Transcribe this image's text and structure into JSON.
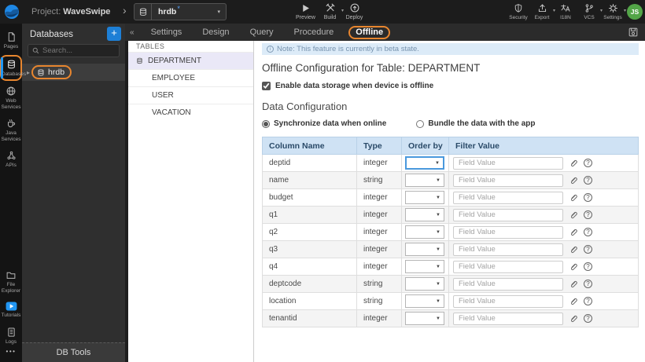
{
  "header": {
    "project_prefix": "Project:",
    "project_name": "WaveSwipe",
    "db_selector_value": "hrdb",
    "db_dirty": "*",
    "preview_label": "Preview",
    "build_label": "Build",
    "deploy_label": "Deploy",
    "security_label": "Security",
    "export_label": "Export",
    "i18n_label": "I18N",
    "vcs_label": "VCS",
    "settings_label": "Settings",
    "avatar_initials": "JS"
  },
  "sidebar": {
    "items": [
      {
        "label": "Pages"
      },
      {
        "label": "Databases"
      },
      {
        "label": "Web Services"
      },
      {
        "label": "Java Services"
      },
      {
        "label": "APIs"
      }
    ],
    "bottom_items": [
      {
        "label": "File Explorer"
      },
      {
        "label": "Tutorials"
      },
      {
        "label": "Logs"
      }
    ],
    "more_label": "•••"
  },
  "db_panel": {
    "title": "Databases",
    "search_placeholder": "Search...",
    "db_name": "hrdb",
    "db_tools_label": "DB Tools"
  },
  "tabs": [
    "Settings",
    "Design",
    "Query",
    "Procedure",
    "Offline"
  ],
  "tables_panel": {
    "title": "TABLES",
    "items": [
      "DEPARTMENT",
      "EMPLOYEE",
      "USER",
      "VACATION"
    ]
  },
  "content": {
    "note": "Note: This feature is currently in beta state.",
    "title": "Offline Configuration for Table: DEPARTMENT",
    "enable_checkbox_label": "Enable data storage when device is offline",
    "section_title": "Data Configuration",
    "radio_sync_label": "Synchronize data when online",
    "radio_bundle_label": "Bundle the data with the app",
    "table": {
      "headers": [
        "Column Name",
        "Type",
        "Order by",
        "Filter Value"
      ],
      "filter_placeholder": "Field Value",
      "rows": [
        {
          "name": "deptid",
          "type": "integer"
        },
        {
          "name": "name",
          "type": "string"
        },
        {
          "name": "budget",
          "type": "integer"
        },
        {
          "name": "q1",
          "type": "integer"
        },
        {
          "name": "q2",
          "type": "integer"
        },
        {
          "name": "q3",
          "type": "integer"
        },
        {
          "name": "q4",
          "type": "integer"
        },
        {
          "name": "deptcode",
          "type": "string"
        },
        {
          "name": "location",
          "type": "string"
        },
        {
          "name": "tenantid",
          "type": "integer"
        }
      ]
    }
  },
  "icons": {
    "chevron_right": "›",
    "caret_down": "▾",
    "select_caret": "▼",
    "collapse_left": "«",
    "expand_right": "▸",
    "plus": "+",
    "question_mark": "?",
    "info_i": "i"
  },
  "colors": {
    "accent_blue": "#2196f3",
    "annotation_orange": "#e8862f",
    "note_bg": "#dcebf8",
    "table_header_bg": "#cfe2f4",
    "avatar_green": "#53a548"
  }
}
